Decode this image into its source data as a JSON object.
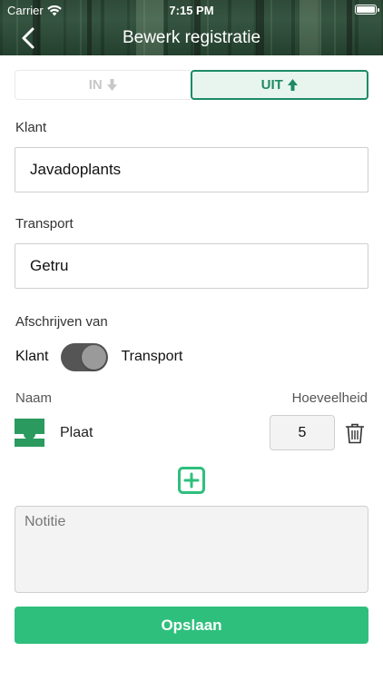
{
  "status_bar": {
    "carrier": "Carrier",
    "time": "7:15 PM"
  },
  "nav": {
    "title": "Bewerk registratie",
    "back_icon": "chevron-left-icon"
  },
  "direction": {
    "in_label": "IN",
    "out_label": "UIT",
    "selected": "UIT"
  },
  "client": {
    "label": "Klant",
    "value": "Javadoplants"
  },
  "transport": {
    "label": "Transport",
    "value": "Getru"
  },
  "write_off": {
    "label": "Afschrijven van",
    "left_option": "Klant",
    "right_option": "Transport",
    "selected": "Transport"
  },
  "items": {
    "name_header": "Naam",
    "quantity_header": "Hoeveelheid",
    "rows": [
      {
        "name": "Plaat",
        "quantity": "5"
      }
    ]
  },
  "notes": {
    "placeholder": "Notitie"
  },
  "save": {
    "label": "Opslaan"
  },
  "colors": {
    "accent": "#2ebf7d",
    "accent_dark": "#1d8a66"
  }
}
